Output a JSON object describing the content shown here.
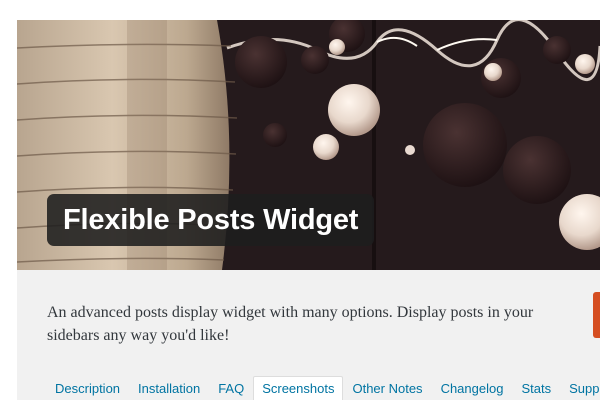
{
  "plugin": {
    "name": "Flexible Posts Widget",
    "description": "An advanced posts display widget with many options. Display posts in your sidebars any way you'd like!"
  },
  "tabs": [
    {
      "label": "Description",
      "active": false
    },
    {
      "label": "Installation",
      "active": false
    },
    {
      "label": "FAQ",
      "active": false
    },
    {
      "label": "Screenshots",
      "active": true
    },
    {
      "label": "Other Notes",
      "active": false
    },
    {
      "label": "Changelog",
      "active": false
    },
    {
      "label": "Stats",
      "active": false
    },
    {
      "label": "Support",
      "active": false
    }
  ],
  "colors": {
    "link": "#0074a2",
    "accent": "#d54e21",
    "content_bg": "#f1f1f1"
  }
}
